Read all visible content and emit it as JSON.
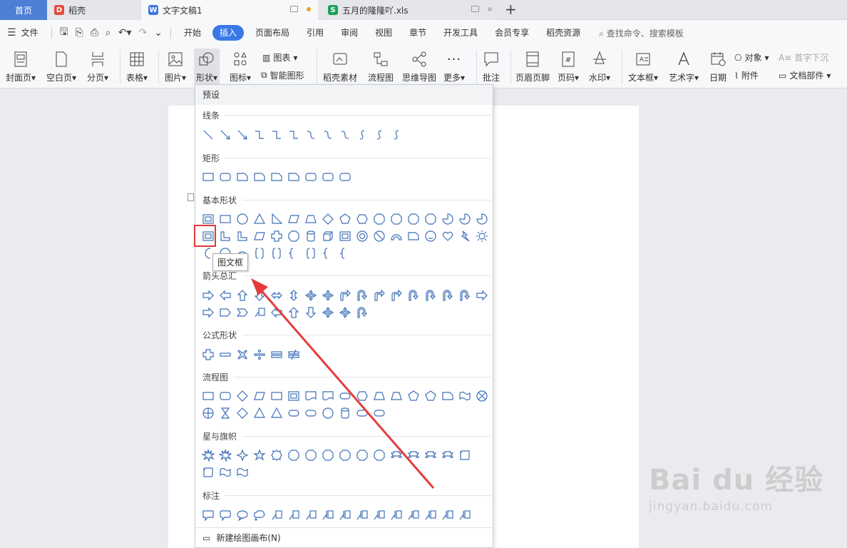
{
  "tabs": {
    "home": "首页",
    "daoke": "稻壳",
    "doc": "文字文稿1",
    "xls": "五月的隆隆吖.xls",
    "add": "+"
  },
  "menu": {
    "file": "文件",
    "items": [
      "开始",
      "插入",
      "页面布局",
      "引用",
      "审阅",
      "视图",
      "章节",
      "开发工具",
      "会员专享",
      "稻壳资源"
    ],
    "active": "插入",
    "search": "查找命令、搜索模板"
  },
  "ribbon": {
    "cover": "封面页",
    "blank": "空白页",
    "pagebreak": "分页",
    "table": "表格",
    "picture": "图片",
    "shape": "形状",
    "icon": "图标",
    "chart": "图表",
    "smartart": "智能图形",
    "material": "稻壳素材",
    "flowchart": "流程图",
    "mindmap": "思维导图",
    "more": "更多",
    "comment": "批注",
    "header_footer": "页眉页脚",
    "page_num": "页码",
    "watermark": "水印",
    "textbox": "文本框",
    "wordart": "艺术字",
    "date": "日期",
    "object": "对象",
    "dropcap": "首字下沉",
    "attachment": "附件",
    "doc_parts": "文档部件"
  },
  "dropdown": {
    "header": "预设",
    "sections": {
      "lines": "线条",
      "rect": "矩形",
      "basic": "基本形状",
      "arrows": "箭头总汇",
      "formula": "公式形状",
      "flow": "流程图",
      "stars": "星与旗帜",
      "callout": "标注"
    },
    "tooltip": "图文框",
    "footer": "新建绘图画布(N)"
  },
  "watermark": {
    "brand": "Bai du 经验",
    "url": "jingyan.baidu.com"
  },
  "colors": {
    "accent": "#3b78e7",
    "shape_stroke": "#3f70b8",
    "highlight": "#e03a3a"
  }
}
